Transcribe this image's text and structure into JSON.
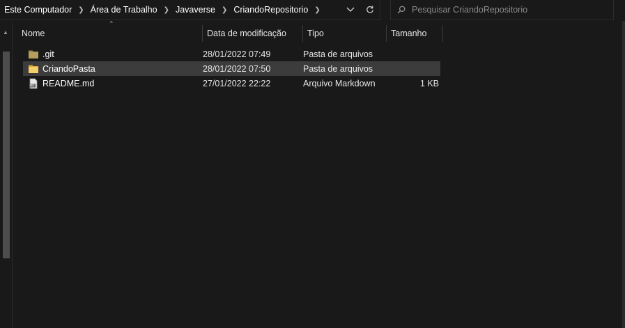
{
  "breadcrumb": [
    "Este Computador",
    "Área de Trabalho",
    "Javaverse",
    "CriandoRepositorio"
  ],
  "search": {
    "placeholder": "Pesquisar CriandoRepositorio"
  },
  "columns": {
    "name": "Nome",
    "date": "Data de modificação",
    "type": "Tipo",
    "size": "Tamanho"
  },
  "files": [
    {
      "name": ".git",
      "date": "28/01/2022 07:49",
      "type": "Pasta de arquivos",
      "size": "",
      "icon": "folder-icon"
    },
    {
      "name": "CriandoPasta",
      "date": "28/01/2022 07:50",
      "type": "Pasta de arquivos",
      "size": "",
      "icon": "folder-icon"
    },
    {
      "name": "README.md",
      "date": "27/01/2022 22:22",
      "type": "Arquivo Markdown",
      "size": "1 KB",
      "icon": "markdown-file-icon"
    }
  ],
  "colors": {
    "background": "#191919",
    "selection": "#3c3c3c",
    "folder": "#e8c25a"
  }
}
